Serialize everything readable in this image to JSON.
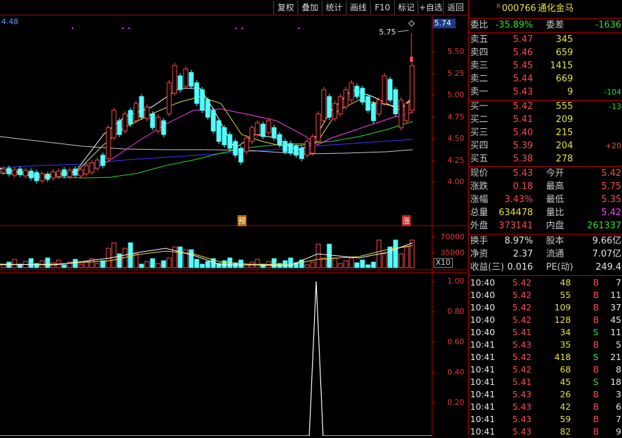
{
  "toolbar": {
    "buttons": [
      "复权",
      "叠加",
      "统计",
      "画线",
      "F10",
      "标记",
      "+自选",
      "返回"
    ]
  },
  "header": {
    "r_badge": "R",
    "code": "000766",
    "name": "通化金马"
  },
  "price_chart": {
    "top_left_value": "4.48",
    "high_marker": "5.75",
    "current_price_tag": "5.74",
    "y_ticks": [
      "5.50",
      "5.25",
      "5.00",
      "4.75",
      "4.50",
      "4.25",
      "4.00"
    ],
    "markers": [
      "预",
      "涨"
    ]
  },
  "volume_chart": {
    "y_ticks": [
      "70000",
      "35000"
    ],
    "unit": "X10"
  },
  "indicator_chart": {
    "y_ticks": [
      "1.00",
      "0.80",
      "0.60",
      "0.40",
      "0.20"
    ]
  },
  "order_book": {
    "weibi_label": "委比",
    "weibi_value": "-35.89%",
    "weicha_label": "委差",
    "weicha_value": "-1636",
    "asks": [
      {
        "label": "卖五",
        "price": "5.47",
        "vol": "345",
        "chg": ""
      },
      {
        "label": "卖四",
        "price": "5.46",
        "vol": "659",
        "chg": ""
      },
      {
        "label": "卖三",
        "price": "5.45",
        "vol": "1415",
        "chg": ""
      },
      {
        "label": "卖二",
        "price": "5.44",
        "vol": "669",
        "chg": ""
      },
      {
        "label": "卖一",
        "price": "5.43",
        "vol": "9",
        "chg": "-104"
      }
    ],
    "bids": [
      {
        "label": "买一",
        "price": "5.42",
        "vol": "555",
        "chg": "-13"
      },
      {
        "label": "买二",
        "price": "5.41",
        "vol": "209",
        "chg": ""
      },
      {
        "label": "买三",
        "price": "5.40",
        "vol": "215",
        "chg": ""
      },
      {
        "label": "买四",
        "price": "5.39",
        "vol": "204",
        "chg": "+20"
      },
      {
        "label": "买五",
        "price": "5.38",
        "vol": "278",
        "chg": ""
      }
    ]
  },
  "quote": {
    "xianjia_label": "现价",
    "xianjia": "5.43",
    "jinkai_label": "今开",
    "jinkai": "5.42",
    "zhangdie_label": "涨跌",
    "zhangdie": "0.18",
    "zuigao_label": "最高",
    "zuigao": "5.75",
    "zhangfu_label": "涨幅",
    "zhangfu": "3.43%",
    "zuidi_label": "最低",
    "zuidi": "5.35",
    "zongliang_label": "总量",
    "zongliang": "634478",
    "liangbi_label": "量比",
    "liangbi": "5.42",
    "waipan_label": "外盘",
    "waipan": "373141",
    "neipan_label": "内盘",
    "neipan": "261337",
    "huanshou_label": "换手",
    "huanshou": "8.97%",
    "guben_label": "股本",
    "guben": "9.66亿",
    "jingzi_label": "净资",
    "jingzi": "2.37",
    "liutong_label": "流通",
    "liutong": "7.07亿",
    "shouyi_label": "收益(三)",
    "shouyi": "0.016",
    "pe_label": "PE(动)",
    "pe": "249.4"
  },
  "ticks": [
    {
      "time": "10:40",
      "price": "5.42",
      "vol": "48",
      "side": "B",
      "n": "7"
    },
    {
      "time": "10:40",
      "price": "5.42",
      "vol": "55",
      "side": "B",
      "n": "11"
    },
    {
      "time": "10:40",
      "price": "5.42",
      "vol": "109",
      "side": "B",
      "n": "37"
    },
    {
      "time": "10:40",
      "price": "5.42",
      "vol": "128",
      "side": "B",
      "n": "45"
    },
    {
      "time": "10:40",
      "price": "5.41",
      "vol": "34",
      "side": "S",
      "n": "11"
    },
    {
      "time": "10:41",
      "price": "5.43",
      "vol": "35",
      "side": "B",
      "n": "5"
    },
    {
      "time": "10:41",
      "price": "5.42",
      "vol": "418",
      "side": "S",
      "n": "21"
    },
    {
      "time": "10:41",
      "price": "5.42",
      "vol": "68",
      "side": "B",
      "n": "8"
    },
    {
      "time": "10:41",
      "price": "5.41",
      "vol": "45",
      "side": "S",
      "n": "18"
    },
    {
      "time": "10:41",
      "price": "5.43",
      "vol": "26",
      "side": "B",
      "n": "3"
    },
    {
      "time": "10:41",
      "price": "5.43",
      "vol": "42",
      "side": "B",
      "n": "6"
    },
    {
      "time": "10:41",
      "price": "5.43",
      "vol": "59",
      "side": "B",
      "n": "7"
    },
    {
      "time": "10:41",
      "price": "5.43",
      "vol": "82",
      "side": "B",
      "n": "9"
    }
  ],
  "colors": {
    "up": "#ff4a4a",
    "down": "#54ffff",
    "ma5": "#ffffff",
    "ma10": "#e8e23c",
    "ma20": "#ff3cff",
    "ma30": "#29e029",
    "ma60": "#3a3aff"
  }
}
